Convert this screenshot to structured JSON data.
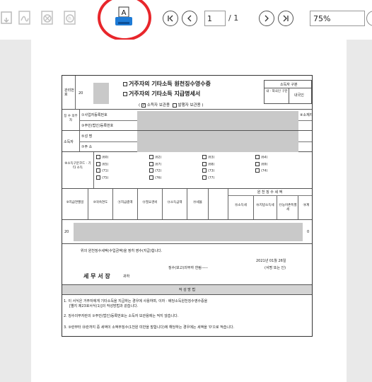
{
  "toolbar": {
    "page_current": "1",
    "page_total": "/ 1",
    "zoom": "75%",
    "print_icon_label": "A"
  },
  "form": {
    "title1": "거주자의 기타소득 원천징수영수증",
    "title2": "거주자의 기타소득 지급명세서",
    "subtitle_open": "( ",
    "subtitle_opt1": "소득자 보관용",
    "subtitle_opt2": "발행자 보관용",
    "subtitle_close": " )",
    "mgmt_label": "관리번호",
    "year_prefix": "20",
    "box_top": "소득자 구분",
    "box_left": "내 · 외국인 구분",
    "box_right": "내국인",
    "payer_label": "징 수 의무자",
    "payer_f1": "①사업자등록번호",
    "payer_f2": "③주민(법인)등록번호",
    "payer_right": "④소재지",
    "earner_label": "소득자",
    "earner_f1": "⑤성 명",
    "earner_f2": "⑦주 소",
    "income_side": "⑧소득구분코드 · 기타 소득",
    "income_options": [
      "(60)",
      "(62)",
      "(63)",
      "(64)",
      "(65)",
      "(67)",
      "(68)",
      "(69)",
      "(71)",
      "(72)",
      "(73)",
      "(74)",
      "(75)",
      "(76)",
      "(77)"
    ],
    "col_heads": [
      "⑨지급연월일",
      "⑩귀속연도",
      "⑪지급총액",
      "⑫필요경비",
      "⑬소득금액",
      "⑭세율",
      "⑮소득세",
      "⑯지방소득세",
      "⑰농어촌특별세",
      "⑱계"
    ],
    "withhold_label": "원 천 징 수 세 액",
    "data_year": "20",
    "data_tail": "0",
    "confirm_text": "위의 원천징수세액(수입금액)을 정히 영수(지급)합니다.",
    "date_text": "2021년 01월 26일",
    "payer_sign": "징수(보고)의무자  한림-----",
    "payer_sign_note": "(서명 또는 인)",
    "tax_office": "세 무 서 장",
    "tax_office_suffix": "귀하",
    "notes_header": "작 성 방 법",
    "notes": [
      "1. 이 서식은 거주자에게 기타소득을 지급하는 경우에 사용하며, 이자 · 배당소득원천징수영수증을",
      "2. 징수의무자란의 ③주민(법인)등록번호는 소득자 보관용에는 적지 않습니다.",
      "3. ⑨란부터 ⑱란까지 중 세액이 소액부징수(1천원 미만을 말합니다)에 해당하는 경우에는 세액을 '0'으로 적습니다."
    ],
    "note1_cont": "[별지 제23호서식(1)]의 작성방법과 같습니다."
  }
}
